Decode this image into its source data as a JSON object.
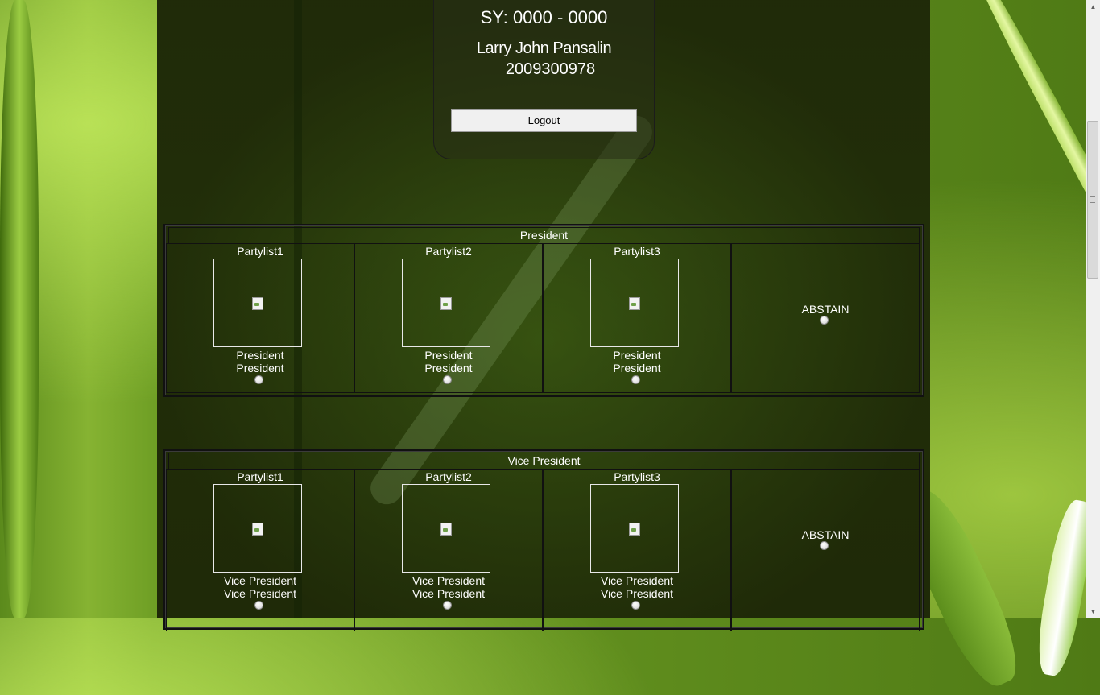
{
  "header": {
    "school_year": "SY: 0000 - 0000",
    "user_name": "Larry John Pansalin",
    "user_id": "2009300978",
    "logout_label": "Logout"
  },
  "ballots": [
    {
      "title": "President",
      "candidates": [
        {
          "party": "Partylist1",
          "line1": "President",
          "line2": "President"
        },
        {
          "party": "Partylist2",
          "line1": "President",
          "line2": "President"
        },
        {
          "party": "Partylist3",
          "line1": "President",
          "line2": "President"
        }
      ],
      "abstain_label": "ABSTAIN"
    },
    {
      "title": "Vice President",
      "candidates": [
        {
          "party": "Partylist1",
          "line1": "Vice President",
          "line2": "Vice President"
        },
        {
          "party": "Partylist2",
          "line1": "Vice President",
          "line2": "Vice President"
        },
        {
          "party": "Partylist3",
          "line1": "Vice President",
          "line2": "Vice President"
        }
      ],
      "abstain_label": "ABSTAIN"
    }
  ],
  "scrollbar": {
    "up_icon": "arrow-up-icon",
    "down_icon": "arrow-down-icon"
  }
}
